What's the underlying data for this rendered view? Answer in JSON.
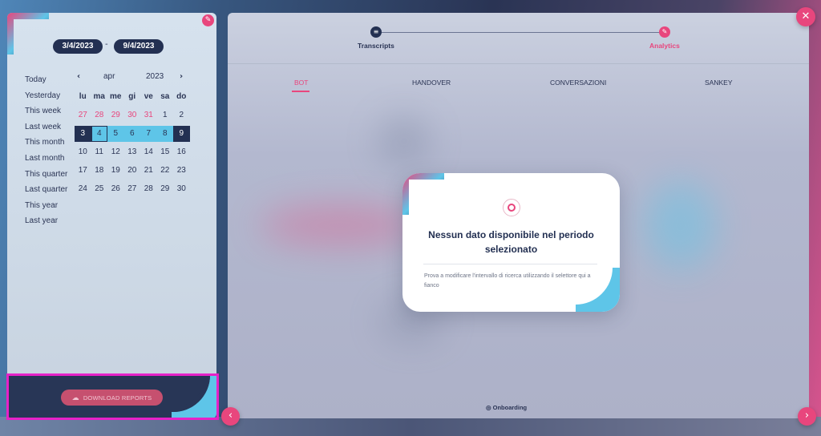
{
  "date_range": {
    "from": "3/4/2023",
    "separator": "-",
    "to": "9/4/2023"
  },
  "presets": [
    "Today",
    "Yesterday",
    "This week",
    "Last week",
    "This month",
    "Last month",
    "This quarter",
    "Last quarter",
    "This year",
    "Last year"
  ],
  "calendar": {
    "prev_icon": "‹",
    "next_icon": "›",
    "month": "apr",
    "year": "2023",
    "weekdays": [
      "lu",
      "ma",
      "me",
      "gi",
      "ve",
      "sa",
      "do"
    ],
    "weeks": [
      [
        {
          "d": "27",
          "t": "other"
        },
        {
          "d": "28",
          "t": "other"
        },
        {
          "d": "29",
          "t": "other"
        },
        {
          "d": "30",
          "t": "other"
        },
        {
          "d": "31",
          "t": "other"
        },
        {
          "d": "1",
          "t": ""
        },
        {
          "d": "2",
          "t": ""
        }
      ],
      [
        {
          "d": "3",
          "t": "endpoint"
        },
        {
          "d": "4",
          "t": "today-mark"
        },
        {
          "d": "5",
          "t": "inrange"
        },
        {
          "d": "6",
          "t": "inrange"
        },
        {
          "d": "7",
          "t": "inrange"
        },
        {
          "d": "8",
          "t": "inrange"
        },
        {
          "d": "9",
          "t": "endpoint"
        }
      ],
      [
        {
          "d": "10",
          "t": ""
        },
        {
          "d": "11",
          "t": ""
        },
        {
          "d": "12",
          "t": ""
        },
        {
          "d": "13",
          "t": ""
        },
        {
          "d": "14",
          "t": ""
        },
        {
          "d": "15",
          "t": ""
        },
        {
          "d": "16",
          "t": ""
        }
      ],
      [
        {
          "d": "17",
          "t": ""
        },
        {
          "d": "18",
          "t": ""
        },
        {
          "d": "19",
          "t": ""
        },
        {
          "d": "20",
          "t": ""
        },
        {
          "d": "21",
          "t": ""
        },
        {
          "d": "22",
          "t": ""
        },
        {
          "d": "23",
          "t": ""
        }
      ],
      [
        {
          "d": "24",
          "t": ""
        },
        {
          "d": "25",
          "t": ""
        },
        {
          "d": "26",
          "t": ""
        },
        {
          "d": "27",
          "t": ""
        },
        {
          "d": "28",
          "t": ""
        },
        {
          "d": "29",
          "t": ""
        },
        {
          "d": "30",
          "t": ""
        }
      ]
    ]
  },
  "download": {
    "label": "DOWNLOAD REPORTS",
    "icon": "☁"
  },
  "stepper": {
    "steps": [
      {
        "label": "Transcripts",
        "icon": "≡"
      },
      {
        "label": "Analytics",
        "icon": "✎"
      }
    ]
  },
  "tabs": [
    {
      "label": "BOT",
      "active": true
    },
    {
      "label": "HANDOVER",
      "active": false
    },
    {
      "label": "CONVERSAZIONI",
      "active": false
    },
    {
      "label": "SANKEY",
      "active": false
    }
  ],
  "modal": {
    "title": "Nessun dato disponibile nel periodo selezionato",
    "body": "Prova a modificare l'intervallo di ricerca utilizzando il selettore qui a fianco"
  },
  "onboarding": {
    "label": "Onboarding",
    "icon": "◎"
  },
  "buttons": {
    "close": "✕",
    "prev": "‹",
    "next": "›",
    "edit": "✎"
  },
  "colors": {
    "accent": "#e8467d",
    "navy": "#233052",
    "range": "#5ec5e8",
    "highlight": "#e622c8"
  }
}
